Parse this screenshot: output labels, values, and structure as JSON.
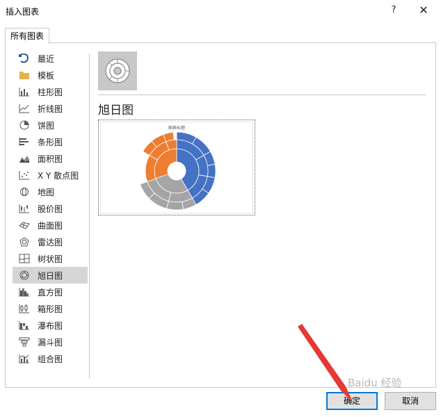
{
  "window": {
    "title": "插入图表",
    "help_label": "?",
    "close_label": "✕"
  },
  "tabs": [
    {
      "label": "所有图表"
    }
  ],
  "sidebar": {
    "items": [
      {
        "label": "最近",
        "icon": "recent-icon"
      },
      {
        "label": "模板",
        "icon": "folder-icon"
      },
      {
        "label": "柱形图",
        "icon": "column-chart-icon"
      },
      {
        "label": "折线图",
        "icon": "line-chart-icon"
      },
      {
        "label": "饼图",
        "icon": "pie-chart-icon"
      },
      {
        "label": "条形图",
        "icon": "bar-chart-icon"
      },
      {
        "label": "面积图",
        "icon": "area-chart-icon"
      },
      {
        "label": "X Y 散点图",
        "icon": "scatter-chart-icon"
      },
      {
        "label": "地图",
        "icon": "map-chart-icon"
      },
      {
        "label": "股价图",
        "icon": "stock-chart-icon"
      },
      {
        "label": "曲面图",
        "icon": "surface-chart-icon"
      },
      {
        "label": "雷达图",
        "icon": "radar-chart-icon"
      },
      {
        "label": "树状图",
        "icon": "treemap-chart-icon"
      },
      {
        "label": "旭日图",
        "icon": "sunburst-chart-icon",
        "selected": true
      },
      {
        "label": "直方图",
        "icon": "histogram-chart-icon"
      },
      {
        "label": "箱形图",
        "icon": "box-chart-icon"
      },
      {
        "label": "瀑布图",
        "icon": "waterfall-chart-icon"
      },
      {
        "label": "漏斗图",
        "icon": "funnel-chart-icon"
      },
      {
        "label": "组合图",
        "icon": "combo-chart-icon"
      }
    ]
  },
  "main": {
    "heading": "旭日图",
    "preview_title": "图表标题"
  },
  "buttons": {
    "ok": "确定",
    "cancel": "取消"
  },
  "colors": {
    "blue": "#4472c4",
    "orange": "#ed7d31",
    "gray": "#a5a5a5",
    "accent": "#0078d7",
    "annotation_arrow": "#e53935"
  },
  "watermark": "Baidu 经验"
}
